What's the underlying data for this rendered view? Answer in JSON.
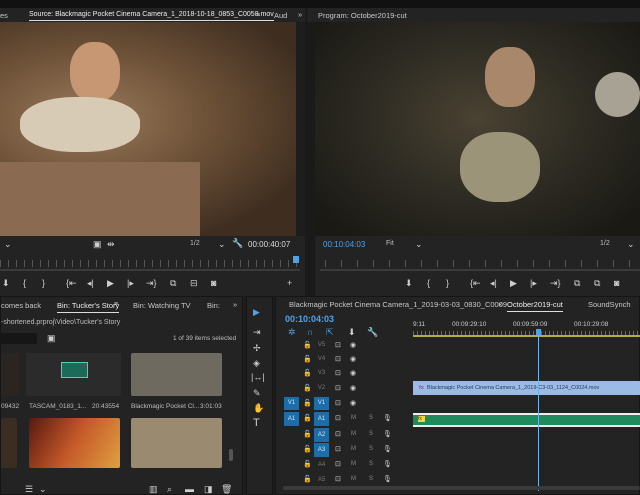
{
  "source_panel": {
    "tabs": [
      "es",
      "Source: Blackmagic Pocket Cinema Camera_1_2018-10-18_0853_C0058.mov",
      "Aud"
    ],
    "overflow": "»",
    "resolution": "1/2",
    "timecode": "00:00:40:07"
  },
  "program_panel": {
    "tab": "Program: October2019-cut",
    "timecode": "00:10:04:03",
    "zoom": "Fit",
    "resolution": "1/2"
  },
  "bin_panel": {
    "tabs": [
      "comes back",
      "Bin: Tucker's Story",
      "Bin: Watching TV",
      "Bin:"
    ],
    "overflow": "»",
    "path": "-shortened.prproj\\Video\\Tucker's Story",
    "selection": "1 of 39 items selected",
    "items": [
      {
        "name": "",
        "duration": "09432"
      },
      {
        "name": "TASCAM_0183_1...",
        "duration": "20:43554"
      },
      {
        "name": "Blackmagic Pocket Cl...",
        "duration": "3:01:03"
      }
    ]
  },
  "timeline": {
    "tabs": [
      "Blackmagic Pocket Cinema Camera_1_2019-03-03_0830_C0009",
      "October2019-cut",
      "SoundSynch"
    ],
    "close": "×",
    "timecode": "00:10:04:03",
    "ruler": [
      "9:11",
      "00:09:29:10",
      "00:09:59:09",
      "00:10:29:08"
    ],
    "video_tracks": [
      "V5",
      "V4",
      "V3",
      "V2",
      "V1"
    ],
    "audio_tracks": [
      "A1",
      "A2",
      "A3",
      "A4",
      "A5"
    ],
    "src_v": "V1",
    "src_a": "A1",
    "mute": "M",
    "solo": "S",
    "fx": "fx",
    "clip_v2": "Blackmagic Pocket Cinema Camera_1_2019-C3-03_1124_C0024.mov"
  },
  "colors": {
    "accent": "#4da3e8",
    "clip_video": "#9bbbe6",
    "clip_audio": "#1f8a5c"
  }
}
